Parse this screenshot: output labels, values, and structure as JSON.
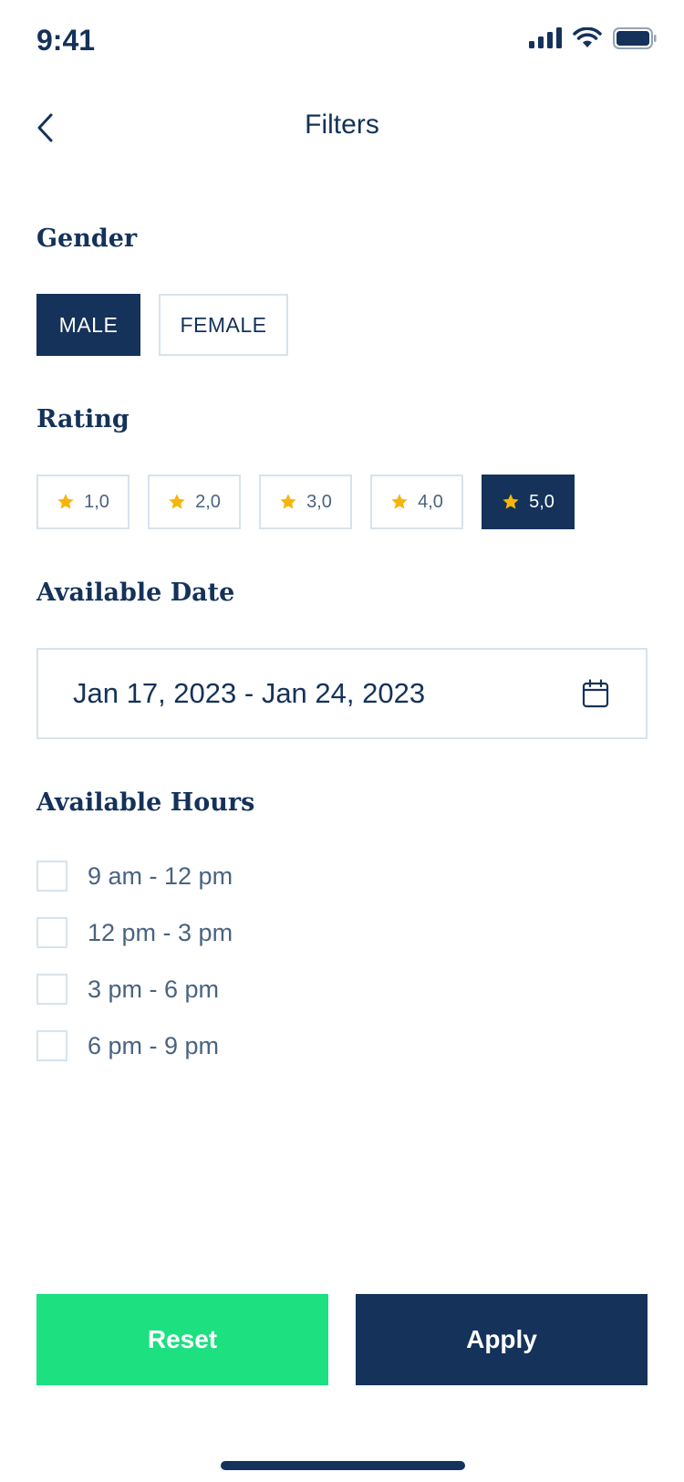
{
  "status_bar": {
    "time": "9:41"
  },
  "header": {
    "title": "Filters"
  },
  "gender": {
    "label": "Gender",
    "options": [
      {
        "label": "MALE",
        "selected": true
      },
      {
        "label": "FEMALE",
        "selected": false
      }
    ]
  },
  "rating": {
    "label": "Rating",
    "options": [
      {
        "label": "1,0",
        "selected": false
      },
      {
        "label": "2,0",
        "selected": false
      },
      {
        "label": "3,0",
        "selected": false
      },
      {
        "label": "4,0",
        "selected": false
      },
      {
        "label": "5,0",
        "selected": true
      }
    ],
    "star_color": "#f5b50a"
  },
  "available_date": {
    "label": "Available Date",
    "value": "Jan 17, 2023 - Jan 24, 2023",
    "icon": "calendar-icon"
  },
  "available_hours": {
    "label": "Available Hours",
    "options": [
      {
        "label": "9 am - 12 pm",
        "checked": false
      },
      {
        "label": "12 pm - 3 pm",
        "checked": false
      },
      {
        "label": "3 pm - 6 pm",
        "checked": false
      },
      {
        "label": "6 pm - 9 pm",
        "checked": false
      }
    ]
  },
  "actions": {
    "reset_label": "Reset",
    "apply_label": "Apply"
  },
  "colors": {
    "primary": "#14325a",
    "accent": "#1de080",
    "border": "#d7e3ee",
    "star": "#f5b50a"
  }
}
